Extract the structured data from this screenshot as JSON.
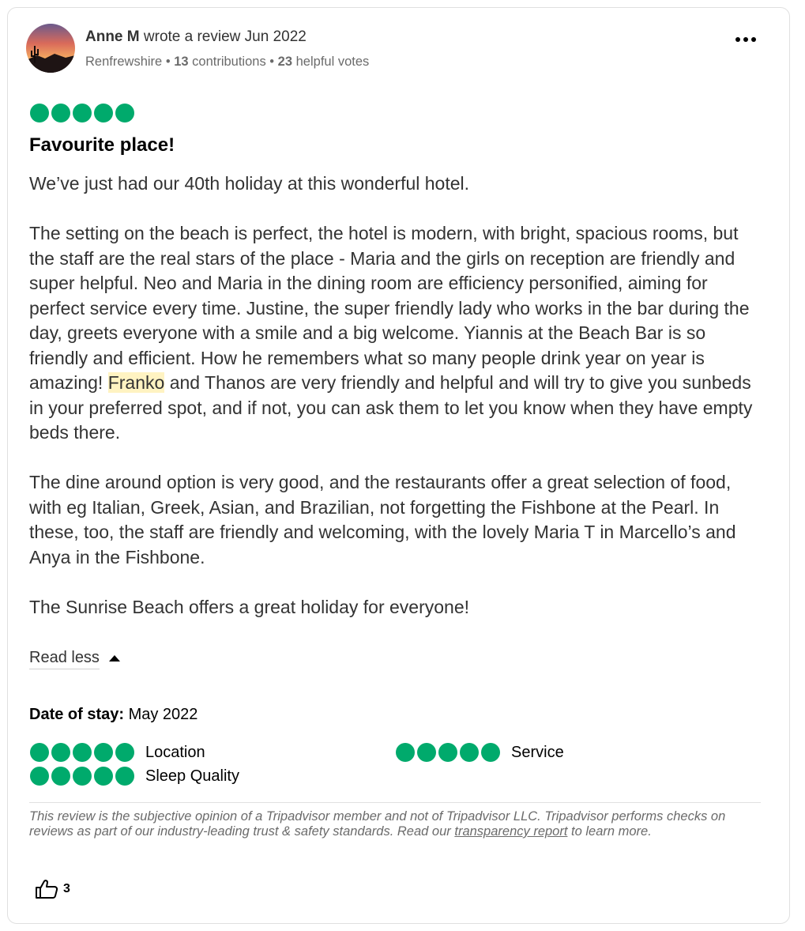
{
  "review": {
    "author": "Anne M",
    "wrote_text": "wrote a review Jun 2022",
    "location": "Renfrewshire",
    "sep": "•",
    "contributions_count": "13",
    "contributions_label": "contributions",
    "helpful_votes_count": "23",
    "helpful_votes_label": "helpful votes",
    "rating": 5,
    "title": "Favourite place!",
    "paragraphs": [
      "We’ve just had our 40th holiday at this wonderful hotel.",
      "The dine around option is very good, and the restaurants offer a great selection of food, with eg Italian, Greek, Asian, and Brazilian, not forgetting the Fishbone at the Pearl. In these, too, the staff are friendly and welcoming, with the lovely Maria T in Marcello’s and Anya in the Fishbone.",
      "The Sunrise Beach offers a great holiday for everyone!"
    ],
    "paragraph2_before": "The setting on the beach is perfect, the hotel is modern, with bright, spacious rooms, but the staff are the real stars of the place - Maria and the girls on reception are friendly and super helpful. Neo and Maria in the dining room are efficiency personified, aiming for perfect service every time. Justine, the super friendly lady who works in the bar during the day, greets everyone with a smile and a big welcome. Yiannis at the Beach Bar is so friendly and efficient. How he remembers what so many people drink year on year is amazing! ",
    "paragraph2_highlight": "Franko",
    "paragraph2_after": " and Thanos are very friendly and helpful and will try to give you sunbeds in your preferred spot, and if not, you can ask them to let you know when they have empty beds there.",
    "read_less": "Read less",
    "date_of_stay_label": "Date of stay:",
    "date_of_stay_value": "May 2022",
    "subratings": [
      {
        "label": "Location",
        "rating": 5
      },
      {
        "label": "Service",
        "rating": 5
      },
      {
        "label": "Sleep Quality",
        "rating": 5
      }
    ],
    "disclaimer_before": "This review is the subjective opinion of a Tripadvisor member and not of Tripadvisor LLC. Tripadvisor performs checks on reviews as part of our industry-leading trust & safety standards. Read our ",
    "disclaimer_link": "transparency report",
    "disclaimer_after": " to learn more.",
    "helpful_count": "3"
  },
  "colors": {
    "bubble": "#00aa6c",
    "highlight": "#fff3c2",
    "muted_text": "#6b6b6b"
  },
  "icons": {
    "more": "more-horizontal-icon",
    "caret": "caret-up-icon",
    "thumbs_up": "thumbs-up-icon"
  }
}
